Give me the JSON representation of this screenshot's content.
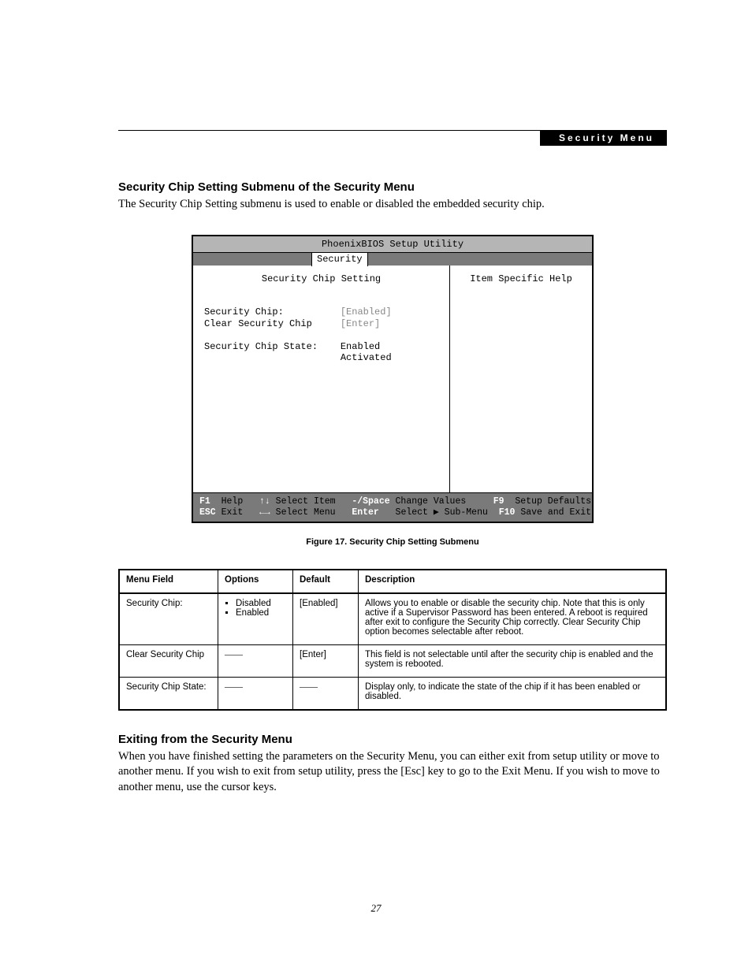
{
  "header": {
    "strip": "Security Menu"
  },
  "section1": {
    "heading": "Security Chip Setting Submenu of the Security Menu",
    "body": "The Security Chip Setting submenu is used to enable or disabled the embedded security chip."
  },
  "bios": {
    "title": "PhoenixBIOS Setup Utility",
    "tab": "Security",
    "panel_left_title": "Security Chip Setting",
    "panel_right_title": "Item Specific Help",
    "fields": {
      "chip_label": "Security Chip:",
      "chip_value": "[Enabled]",
      "clear_label": "Clear Security Chip",
      "clear_value": "[Enter]",
      "state_label": "Security Chip State:",
      "state_value1": "Enabled",
      "state_value2": "Activated"
    },
    "footer": {
      "r1c1k": "F1",
      "r1c1t": "Help",
      "r1c2k": "↑↓",
      "r1c2t": "Select Item",
      "r1c3k": "-/Space",
      "r1c3t": "Change Values",
      "r1c4k": "F9",
      "r1c4t": "Setup Defaults",
      "r2c1k": "ESC",
      "r2c1t": "Exit",
      "r2c2k": "←→",
      "r2c2t": "Select Menu",
      "r2c3k": "Enter",
      "r2c3t": "Select ▶ Sub-Menu",
      "r2c4k": "F10",
      "r2c4t": "Save and Exit"
    }
  },
  "figure_caption": "Figure 17.  Security Chip Setting Submenu",
  "table": {
    "headers": {
      "field": "Menu Field",
      "options": "Options",
      "def": "Default",
      "desc": "Description"
    },
    "rows": [
      {
        "field": "Security Chip:",
        "options": [
          "Disabled",
          "Enabled"
        ],
        "def": "[Enabled]",
        "desc": "Allows you to enable or disable the security chip. Note that this is only active if a Supervisor Password has been entered. A reboot is required after exit to configure the Security Chip correctly. Clear Security Chip option becomes selectable after reboot."
      },
      {
        "field": "Clear Security Chip",
        "options_text": "——",
        "def": "[Enter]",
        "desc": "This field is not selectable until after the security chip is enabled and the system is rebooted."
      },
      {
        "field": "Security Chip State:",
        "options_text": "——",
        "def": "——",
        "desc": "Display only, to indicate the state of the chip if it has been enabled or disabled."
      }
    ]
  },
  "section2": {
    "heading": "Exiting from the Security Menu",
    "body": "When you have finished setting the parameters on the Security Menu, you can either exit from setup utility or move to another menu. If you wish to exit from setup utility, press the [Esc] key to go to the Exit Menu. If you wish to move to another menu, use the cursor keys."
  },
  "page_number": "27"
}
